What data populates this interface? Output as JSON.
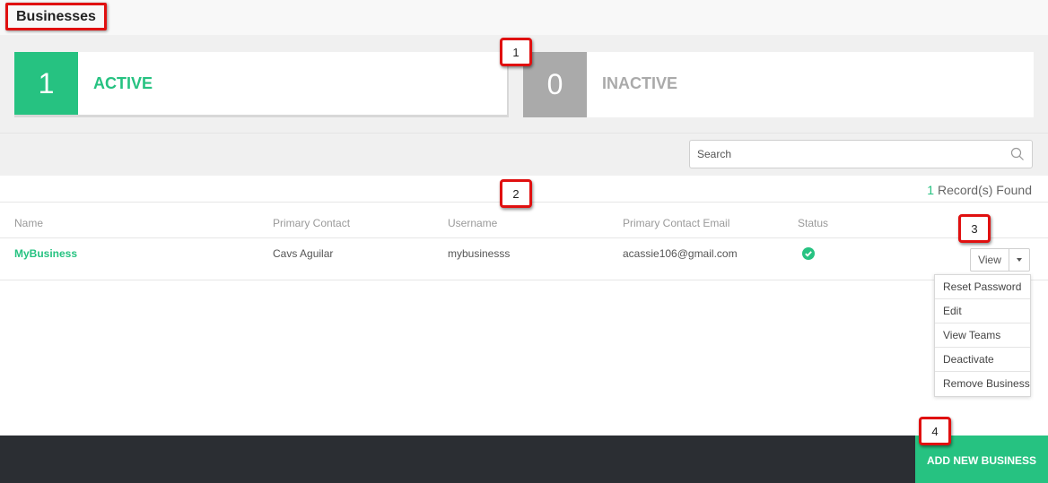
{
  "header": {
    "title": "Businesses"
  },
  "stats": {
    "active": {
      "count": "1",
      "label": "ACTIVE"
    },
    "inactive": {
      "count": "0",
      "label": "INACTIVE"
    }
  },
  "search": {
    "placeholder": "Search",
    "icon": "search-icon"
  },
  "records": {
    "count": "1",
    "suffix": " Record(s) Found"
  },
  "table": {
    "columns": [
      "Name",
      "Primary Contact",
      "Username",
      "Primary Contact Email",
      "Status"
    ],
    "rows": [
      {
        "name": "MyBusiness",
        "primary_contact": "Cavs Aguilar",
        "username": "mybusinesss",
        "email": "acassie106@gmail.com",
        "status": "active",
        "status_icon": "check-circle-icon"
      }
    ]
  },
  "actions": {
    "view_label": "View",
    "menu": [
      "Reset Password",
      "Edit",
      "View Teams",
      "Deactivate",
      "Remove Business"
    ]
  },
  "footer": {
    "add_label": "ADD NEW BUSINESS"
  },
  "callouts": [
    "1",
    "2",
    "3",
    "4"
  ],
  "colors": {
    "accent": "#26c281",
    "inactive": "#aaaaaa",
    "footer": "#2b2e33",
    "callout_border": "#e01010"
  }
}
